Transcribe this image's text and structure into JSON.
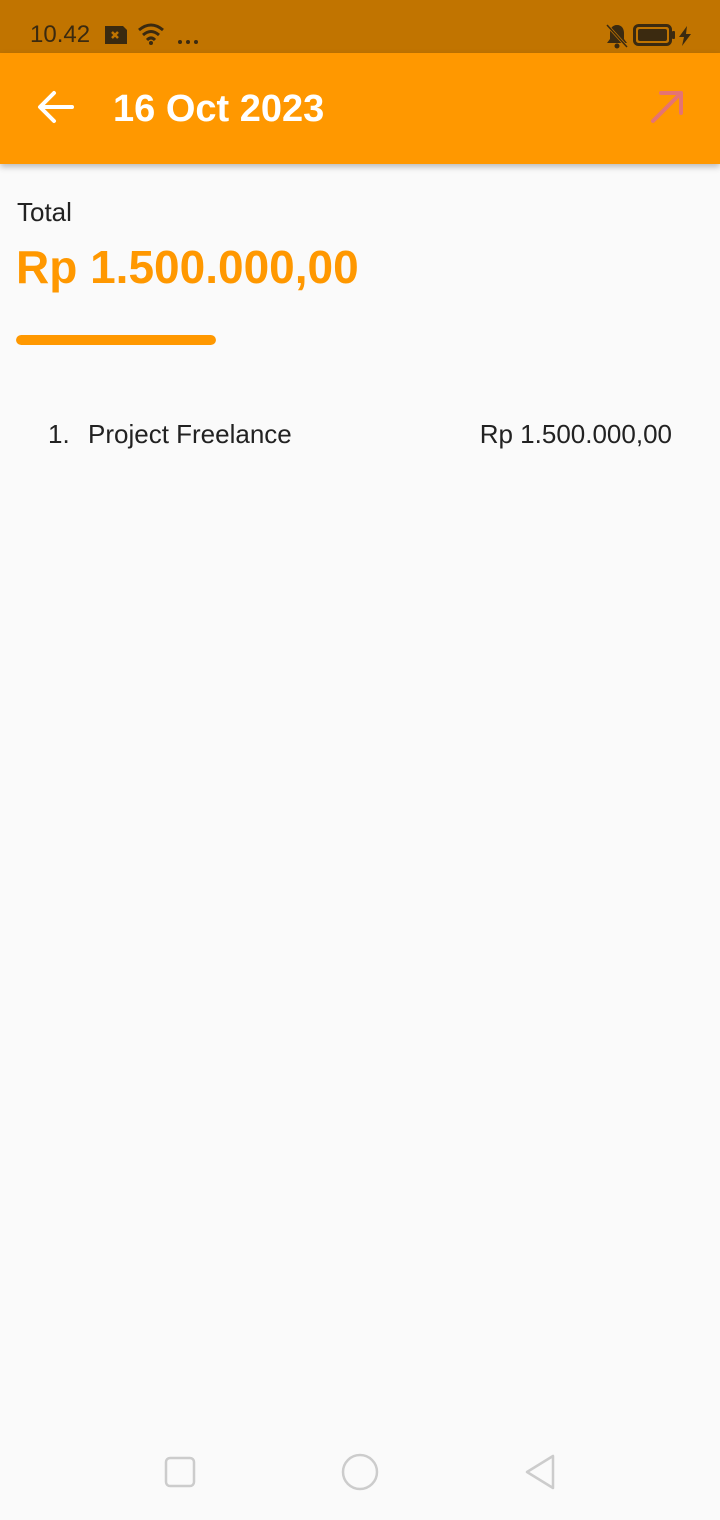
{
  "status_bar": {
    "time": "10.42",
    "icons": [
      "sim-card-icon",
      "wifi-icon",
      "more-dots-icon",
      "bell-off-icon",
      "battery-icon",
      "charging-icon"
    ]
  },
  "app_bar": {
    "title": "16 Oct 2023",
    "back_icon": "arrow-left-icon",
    "action_icon": "arrow-up-right-icon",
    "action_color": "#e57373"
  },
  "summary": {
    "label": "Total",
    "amount": "Rp 1.500.000,00",
    "progress_fraction": 1.0,
    "accent_color": "#ff9800"
  },
  "items": [
    {
      "index": "1.",
      "name": "Project Freelance",
      "amount": "Rp 1.500.000,00"
    }
  ],
  "nav_bar": {
    "icons": [
      "recent-apps-icon",
      "home-icon",
      "back-triangle-icon"
    ]
  }
}
